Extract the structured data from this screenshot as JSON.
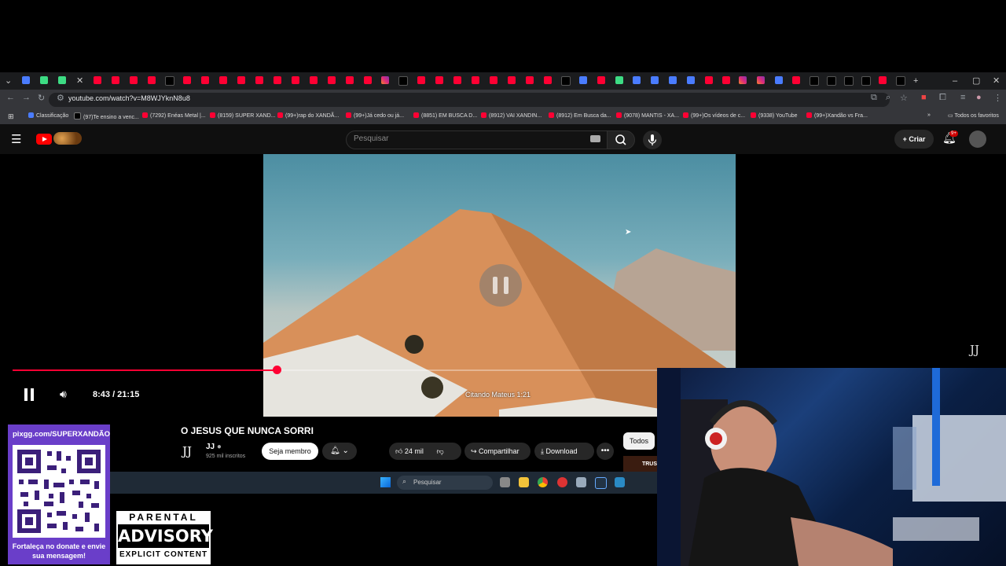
{
  "browser": {
    "url": "youtube.com/watch?v=M8WJYknN8u8",
    "bookmarks": [
      "Classificação",
      "(97)Te ensino a venc...",
      "(7292) Enéas Metal |...",
      "(8159) SUPER XAND...",
      "(99+)rap do XANDÃ...",
      "(99+)Já cedo ou já...",
      "(8851) EM BUSCA D...",
      "(8912) VAI XANDIN...",
      "(8912) Em Busca da...",
      "(9078) MANTIS - XA...",
      "(99+)Os vídeos de c...",
      "(9338) YouTube",
      "(99+)Xandão vs Fra..."
    ],
    "all_favorites": "Todos os favoritos"
  },
  "youtube": {
    "search_placeholder": "Pesquisar",
    "create_label": "Criar",
    "notif_badge": "9+"
  },
  "player": {
    "current_time": "8:43",
    "duration": "21:15",
    "time_display": "8:43 / 21:15",
    "progress_fraction": 0.41,
    "caption": "Citando Mateus 1:21",
    "watermark": "JJ"
  },
  "video": {
    "title": "O JESUS QUE NUNCA SORRI",
    "channel_logo": "JJ",
    "channel_name": "JJ",
    "subscribers": "925 mil inscritos",
    "join_label": "Seja membro",
    "likes": "24 mil",
    "share_label": "Compartilhar",
    "download_label": "Download",
    "more_label": "•••",
    "filter_label": "Todos",
    "side_thumb_text": "TRUS"
  },
  "taskbar": {
    "search_placeholder": "Pesquisar"
  },
  "overlay": {
    "donate_url": "pixgg.com/SUPERXANDÃO",
    "donate_message": "Fortaleça no donate e envie sua mensagem!",
    "advisory_top": "PARENTAL",
    "advisory_mid": "ADVISORY",
    "advisory_bot": "EXPLICIT CONTENT"
  },
  "colors": {
    "yt_red": "#ff0033",
    "donate_purple": "#6a3ec9"
  }
}
